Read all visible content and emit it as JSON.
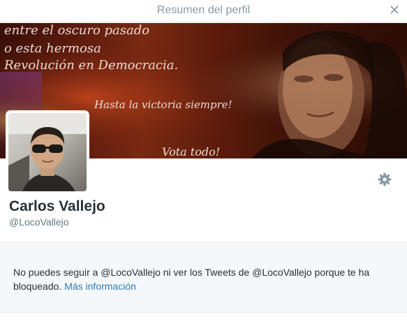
{
  "modal": {
    "title": "Resumen del perfil",
    "close_icon": "close-icon"
  },
  "banner": {
    "line1": "entre el oscuro pasado",
    "line2": "o esta hermosa",
    "line3": "Revolución en Democracia.",
    "line4": "Hasta la victoria siempre!",
    "line5": "Vota todo!"
  },
  "profile": {
    "display_name": "Carlos Vallejo",
    "screen_name": "@LocoVallejo",
    "settings_icon": "gear-icon"
  },
  "notice": {
    "text": "No puedes seguir a @LocoVallejo ni ver los Tweets de @LocoVallejo porque te ha bloqueado.",
    "link_label": "Más información"
  },
  "colors": {
    "title_gray": "#8899a6",
    "name_dark": "#292f33",
    "handle_gray": "#66757f",
    "link_blue": "#2b7bb9",
    "notice_bg": "#f5f8fa",
    "border": "#e1e8ed"
  }
}
